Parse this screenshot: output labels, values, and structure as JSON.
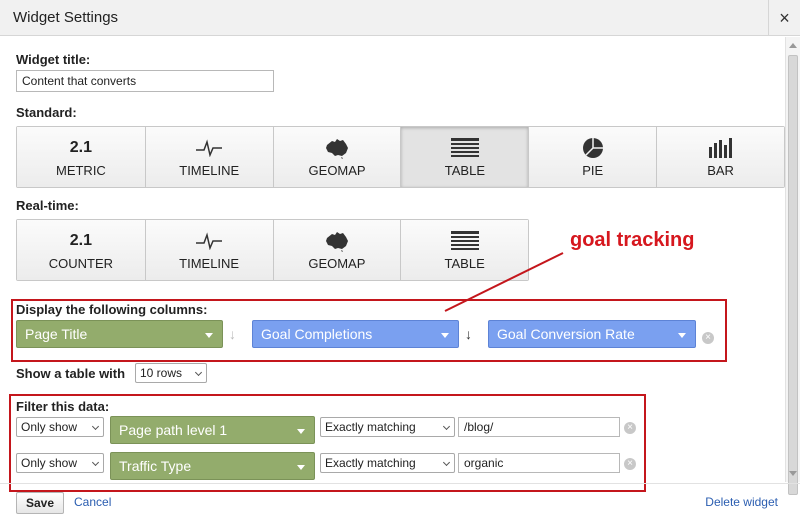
{
  "dialog": {
    "title": "Widget Settings",
    "close_glyph": "×"
  },
  "widget_title": {
    "label": "Widget title:",
    "value": "Content that converts"
  },
  "standard": {
    "label": "Standard:",
    "selected": "TABLE",
    "buttons": [
      {
        "icon_text": "2.1",
        "label": "METRIC",
        "icon": "metric-number"
      },
      {
        "icon_text": "",
        "label": "TIMELINE",
        "icon": "timeline-icon"
      },
      {
        "icon_text": "",
        "label": "GEOMAP",
        "icon": "geomap-icon"
      },
      {
        "icon_text": "",
        "label": "TABLE",
        "icon": "table-icon"
      },
      {
        "icon_text": "",
        "label": "PIE",
        "icon": "pie-icon"
      },
      {
        "icon_text": "",
        "label": "BAR",
        "icon": "bar-icon"
      }
    ]
  },
  "realtime": {
    "label": "Real-time:",
    "buttons": [
      {
        "icon_text": "2.1",
        "label": "COUNTER",
        "icon": "metric-number"
      },
      {
        "icon_text": "",
        "label": "TIMELINE",
        "icon": "timeline-icon"
      },
      {
        "icon_text": "",
        "label": "GEOMAP",
        "icon": "geomap-icon"
      },
      {
        "icon_text": "",
        "label": "TABLE",
        "icon": "table-icon"
      }
    ]
  },
  "annotation": {
    "text": "goal tracking",
    "color": "#d6171e"
  },
  "columns": {
    "label": "Display the following columns:",
    "items": [
      {
        "label": "Page Title",
        "color": "#93ac6c"
      },
      {
        "label": "Goal Completions",
        "color": "#7aa0f0"
      },
      {
        "label": "Goal Conversion Rate",
        "color": "#7aa0f0"
      }
    ],
    "arrow_glyph": "↓",
    "remove_glyph": "×"
  },
  "rows": {
    "label": "Show a table with",
    "selected": "10 rows"
  },
  "filter": {
    "label": "Filter this data:",
    "rows": [
      {
        "mode": "Only show",
        "dimension": "Page path level 1",
        "match": "Exactly matching",
        "value": "/blog/"
      },
      {
        "mode": "Only show",
        "dimension": "Traffic Type",
        "match": "Exactly matching",
        "value": "organic"
      }
    ],
    "remove_glyph": "×"
  },
  "footer": {
    "save_label": "Save",
    "cancel_label": "Cancel",
    "delete_label": "Delete widget"
  },
  "colors": {
    "red_box": "#c4161c",
    "green_pill": "#93ac6c",
    "blue_pill": "#7aa0f0",
    "link": "#2a5db0"
  }
}
